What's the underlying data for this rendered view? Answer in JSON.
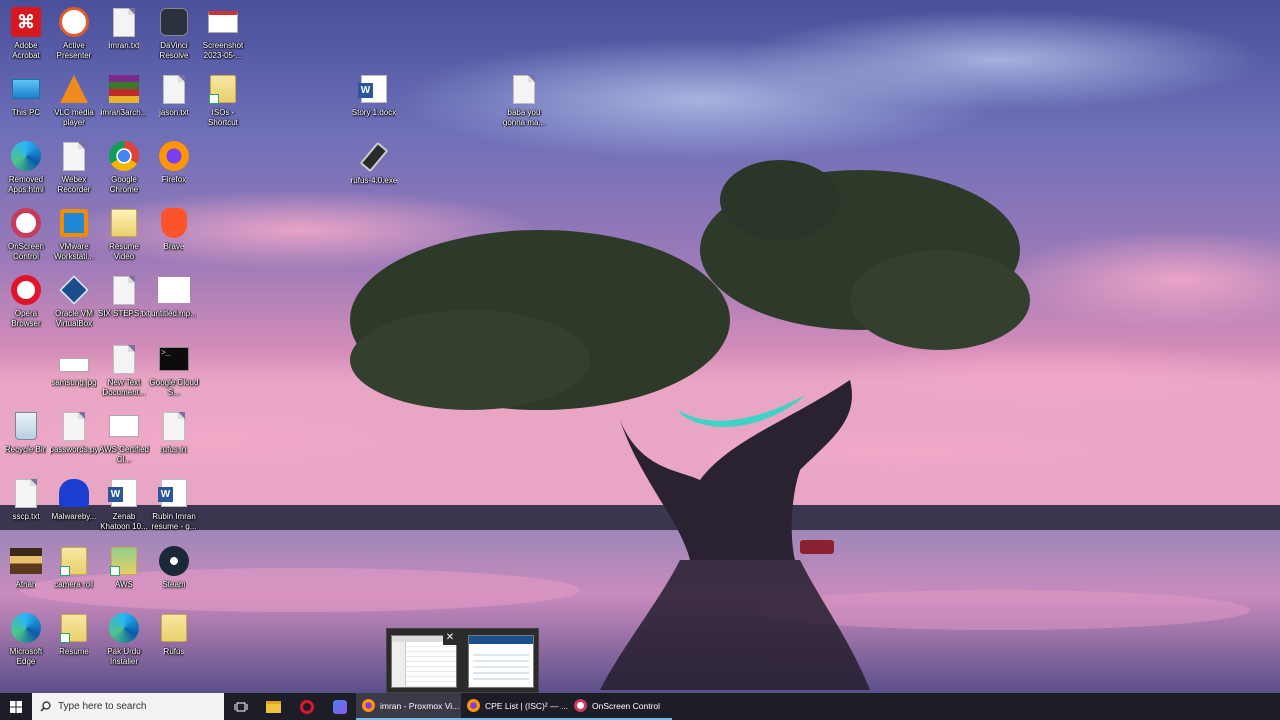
{
  "desktop_icons": [
    {
      "label": "Adobe Acrobat",
      "icon": "adobe-acrobat-icon"
    },
    {
      "label": "Active Presenter",
      "icon": "active-presenter-icon"
    },
    {
      "label": "imran.txt",
      "icon": "text-file-icon"
    },
    {
      "label": "DaVinci Resolve",
      "icon": "davinci-resolve-icon"
    },
    {
      "label": "Screenshot 2023-05-...",
      "icon": "image-file-icon"
    },
    {
      "label": "This PC",
      "icon": "this-pc-icon"
    },
    {
      "label": "VLC media player",
      "icon": "vlc-icon"
    },
    {
      "label": "imran3arch...",
      "icon": "winrar-icon"
    },
    {
      "label": "jason.txt",
      "icon": "text-file-icon"
    },
    {
      "label": "ISOs - Shortcut",
      "icon": "folder-shortcut-icon"
    },
    {
      "label": "Story 1.docx",
      "icon": "word-doc-icon"
    },
    {
      "label": "baba you gonna ma...",
      "icon": "text-file-icon"
    },
    {
      "label": "rufus-4.0.exe",
      "icon": "usb-drive-icon"
    },
    {
      "label": "Removed Apps.html",
      "icon": "edge-icon"
    },
    {
      "label": "Webex Recorder",
      "icon": "file-icon"
    },
    {
      "label": "Google Chrome",
      "icon": "chrome-icon"
    },
    {
      "label": "Firefox",
      "icon": "firefox-icon"
    },
    {
      "label": "OnScreen Control",
      "icon": "onscreen-control-icon"
    },
    {
      "label": "VMware Workstati...",
      "icon": "vmware-icon"
    },
    {
      "label": "Resume Video",
      "icon": "folder-icon"
    },
    {
      "label": "Brave",
      "icon": "brave-icon"
    },
    {
      "label": "Opera Browser",
      "icon": "opera-icon"
    },
    {
      "label": "Oracle VM VirtualBox",
      "icon": "virtualbox-icon"
    },
    {
      "label": "SIX STEPS.txt",
      "icon": "text-file-icon"
    },
    {
      "label": "untitled.mp...",
      "icon": "blank-file-icon"
    },
    {
      "label": "samsung.jpg",
      "icon": "image-file-icon"
    },
    {
      "label": "New Text Document...",
      "icon": "text-file-icon"
    },
    {
      "label": "Google Cloud S...",
      "icon": "terminal-icon"
    },
    {
      "label": "Recycle Bin",
      "icon": "recycle-bin-icon"
    },
    {
      "label": "passwords.py",
      "icon": "text-file-icon"
    },
    {
      "label": "AWS Certified Cl...",
      "icon": "image-file-icon"
    },
    {
      "label": "rufus.ini",
      "icon": "settings-file-icon"
    },
    {
      "label": "sscp.txt",
      "icon": "text-file-icon"
    },
    {
      "label": "Malwareby...",
      "icon": "malwarebytes-icon"
    },
    {
      "label": "Zenab Khatoon 10...",
      "icon": "word-doc-icon"
    },
    {
      "label": "Rubin Imran resume - g...",
      "icon": "word-doc-icon"
    },
    {
      "label": "Athan",
      "icon": "athan-icon"
    },
    {
      "label": "camera roll",
      "icon": "folder-shortcut-icon"
    },
    {
      "label": "AWS",
      "icon": "folder-shortcut-icon"
    },
    {
      "label": "Steam",
      "icon": "steam-icon"
    },
    {
      "label": "Microsoft Edge",
      "icon": "edge-icon"
    },
    {
      "label": "Resume",
      "icon": "folder-shortcut-icon"
    },
    {
      "label": "Pak Urdu Installer",
      "icon": "edge-icon"
    },
    {
      "label": "Rufus",
      "icon": "folder-icon"
    }
  ],
  "taskbar": {
    "search_placeholder": "Type here to search",
    "pinned": [
      "task-view-icon",
      "file-explorer-icon",
      "opera-icon",
      "app-icon"
    ],
    "tasks": [
      {
        "label": "imran - Proxmox Vi...",
        "icon": "firefox-icon",
        "active": true
      },
      {
        "label": "CPE List | (ISC)² — ...",
        "icon": "firefox-icon",
        "active": false
      },
      {
        "label": "OnScreen Control",
        "icon": "onscreen-control-icon",
        "active": false
      }
    ]
  },
  "preview": {
    "close_glyph": "✕"
  },
  "colors": {
    "taskbar_bg": "#1d1d28",
    "accent": "#76b9ed",
    "search_bg": "#f3f3f3"
  }
}
